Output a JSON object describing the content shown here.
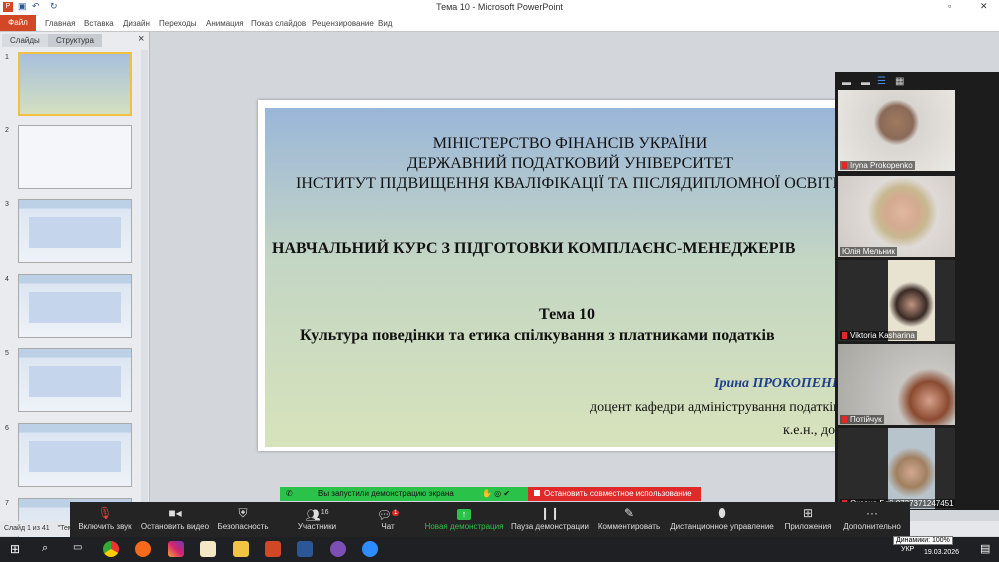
{
  "window": {
    "title": "Тема 10  -  Microsoft PowerPoint"
  },
  "ribbon": {
    "file": "Файл",
    "tabs": [
      "Главная",
      "Вставка",
      "Дизайн",
      "Переходы",
      "Анимация",
      "Показ слайдов",
      "Рецензирование",
      "Вид"
    ]
  },
  "left_panel": {
    "tabs": [
      "Слайды",
      "Структура"
    ],
    "close": "×",
    "slide_numbers": [
      "1",
      "2",
      "3",
      "4",
      "5",
      "6",
      "7"
    ]
  },
  "slide": {
    "lines": [
      "МІНІСТЕРСТВО ФІНАНСІВ УКРАЇНИ",
      "ДЕРЖАВНИЙ ПОДАТКОВИЙ УНІВЕРСИТЕТ",
      "ІНСТИТУТ ПІДВИЩЕННЯ КВАЛІФІКАЦІЇ ТА ПІСЛЯДИПЛОМНОЇ ОСВІТИ"
    ],
    "course": "НАВЧАЛЬНИЙ КУРС З ПІДГОТОВКИ КОМПЛАЄНС-МЕНЕДЖЕРІВ",
    "topic": "Тема 10",
    "topic_title": "Культура поведінки та етика спілкування з платниками податків",
    "author": "Ірина ПРОКОПЕНКО",
    "position": "доцент кафедри адміністрування податків",
    "degree": "к.е.н., доцент"
  },
  "gallery": {
    "participants": [
      "Iryna Prokopenko",
      "Юлія Мельник",
      "Viktoria Kasharina",
      "Потійчук",
      "Оксана Бой 0737371247451"
    ]
  },
  "share": {
    "status": "Вы запустили демонстрацию экрана",
    "stop": "Остановить совместное использование"
  },
  "statusbar": {
    "slide": "Слайд 1 из 41",
    "theme": "\"Тема"
  },
  "zoom_toolbar": [
    {
      "label": "Включить звук",
      "icon": "mic-muted-icon"
    },
    {
      "label": "Остановить видео",
      "icon": "video-icon"
    },
    {
      "label": "Безопасность",
      "icon": "shield-icon"
    },
    {
      "label": "Участники",
      "icon": "participants-icon",
      "count": "16"
    },
    {
      "label": "Чат",
      "icon": "chat-icon",
      "badge": "1"
    },
    {
      "label": "Новая демонстрация",
      "icon": "share-screen-icon"
    },
    {
      "label": "Пауза демонстрации",
      "icon": "pause-icon"
    },
    {
      "label": "Комментировать",
      "icon": "pen-icon"
    },
    {
      "label": "Дистанционное управление",
      "icon": "mouse-icon"
    },
    {
      "label": "Приложения",
      "icon": "apps-icon"
    },
    {
      "label": "Дополнительно",
      "icon": "more-icon"
    }
  ],
  "taskbar": {
    "lang": "УКР",
    "date": "19.03.2026",
    "tooltip": "Динамики: 100%"
  },
  "colors": {
    "file_tab": "#d24726",
    "share_green": "#2bc24a",
    "share_red": "#e02a2a",
    "new_share": "#2bc24a",
    "author": "#1f3f8a"
  }
}
